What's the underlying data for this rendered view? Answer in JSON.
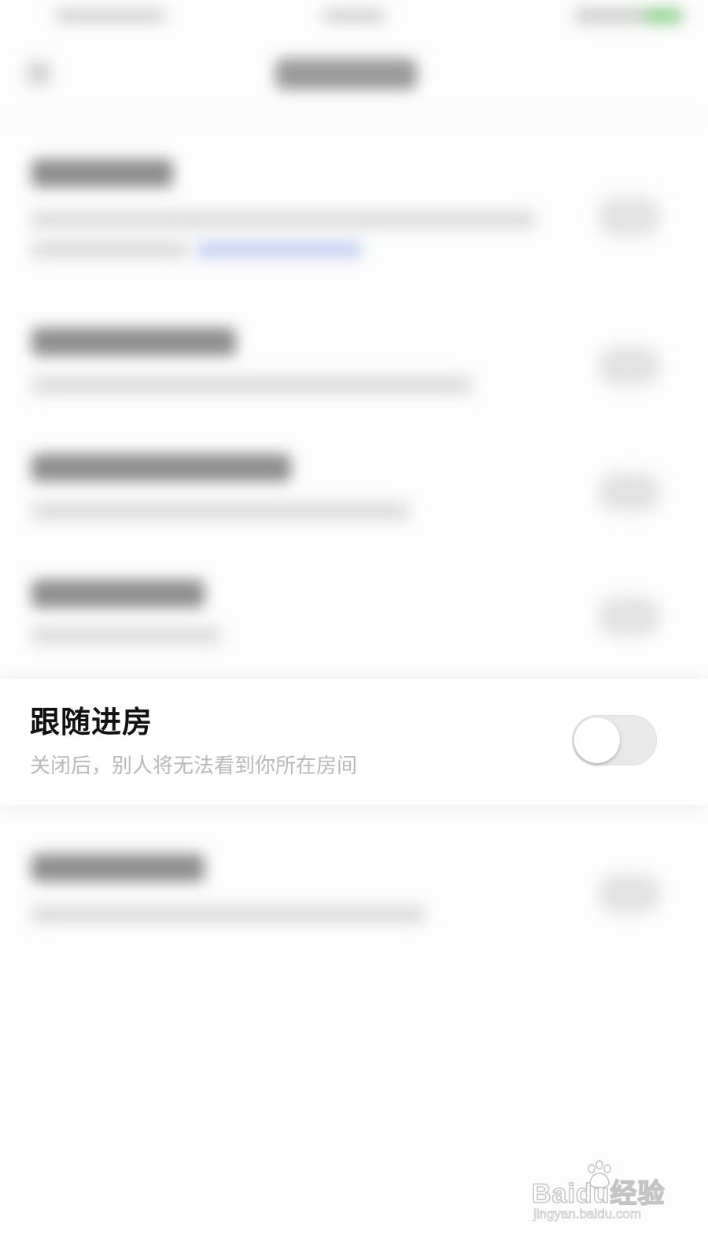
{
  "settings": {
    "follow_room": {
      "title": "跟随进房",
      "description": "关闭后，别人将无法看到你所在房间",
      "toggle_on": false
    }
  },
  "watermark": {
    "logo": "Baidu经验",
    "url": "jingyan.baidu.com"
  },
  "colors": {
    "toggle_off_track": "#e9e9ea",
    "title_text": "#111111",
    "description_text": "#b9b9b9"
  }
}
